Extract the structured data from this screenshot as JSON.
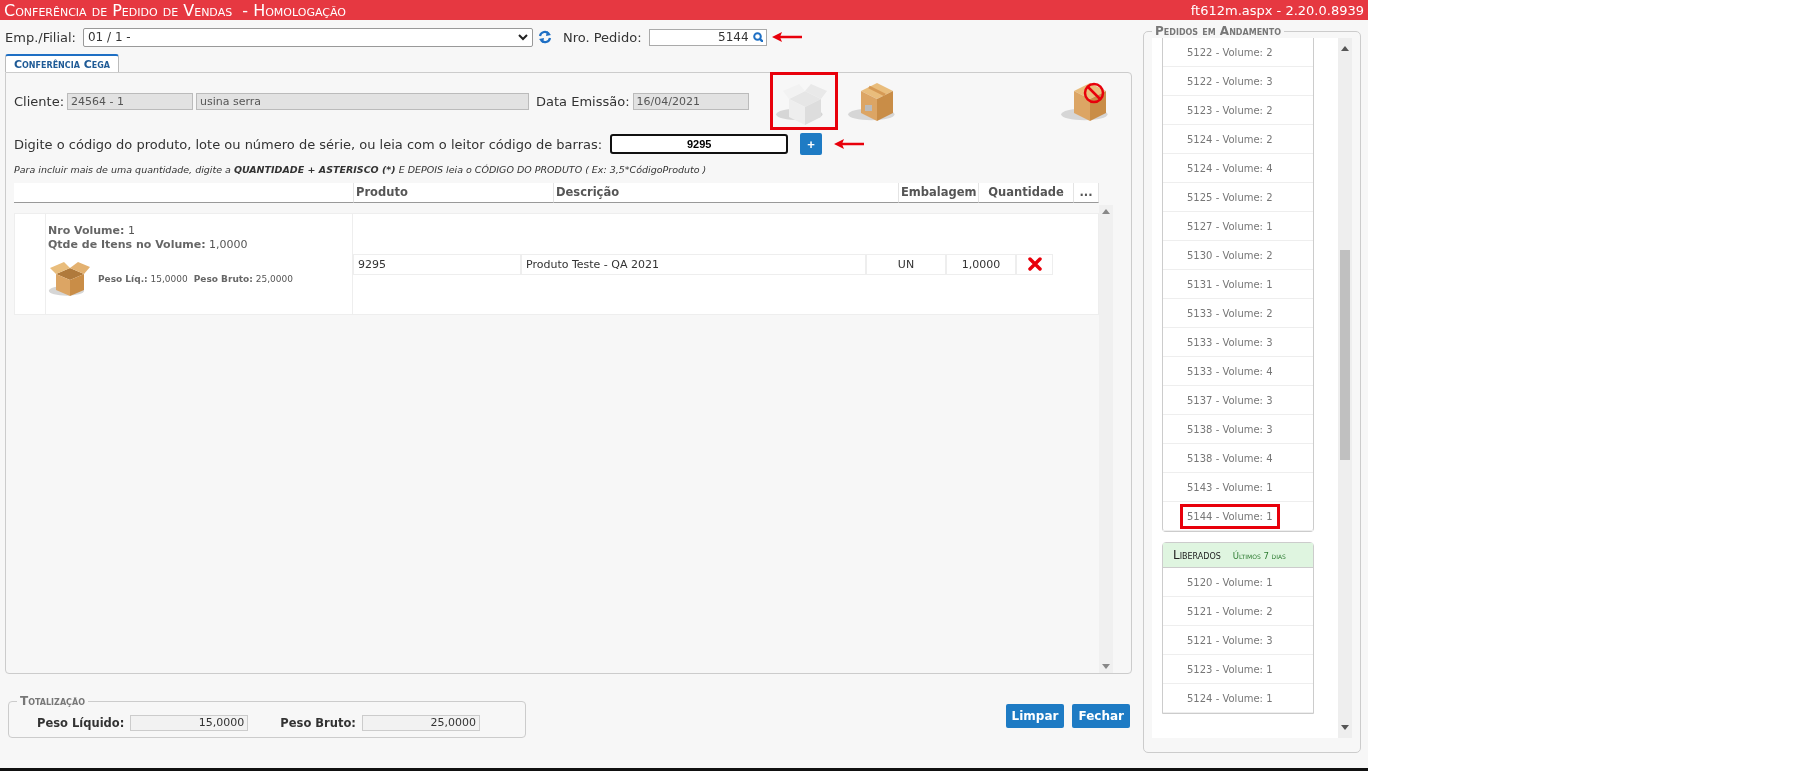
{
  "header": {
    "title": "Conferência de Pedido de Vendas  - Homologação",
    "version": "ft612m.aspx - 2.20.0.8939"
  },
  "filter": {
    "branch_label": "Emp./Filial:",
    "branch_value": "01 / 1 -",
    "order_label": "Nro. Pedido:",
    "order_value": "5144",
    "annotated": true
  },
  "tabs": [
    {
      "label": "Conferência Cega",
      "selected": true
    }
  ],
  "order": {
    "client_label": "Cliente:",
    "client_code": "24564 - 1",
    "client_name": "usina serra",
    "date_label": "Data Emissão:",
    "date_value": "16/04/2021"
  },
  "box_actions": [
    {
      "kind": "empty",
      "highlighted": true
    },
    {
      "kind": "closed",
      "highlighted": false
    },
    {
      "kind": "blocked",
      "highlighted": false
    }
  ],
  "scan": {
    "label": "Digite o código do produto, lote ou número de série, ou leia com o leitor código de barras:",
    "value": "9295",
    "add_button": "+",
    "annotated": true
  },
  "hint": [
    {
      "text": "Para incluir mais de uma quantidade, digite a ",
      "bold": false
    },
    {
      "text": "QUANTIDADE + ASTERISCO (*)",
      "bold": true
    },
    {
      "text": " E DEPOIS leia o CÓDIGO DO PRODUTO ( Ex: 3,5*CódigoProduto )",
      "bold": false
    }
  ],
  "table": {
    "columns": [
      "Produto",
      "Descrição",
      "Embalagem",
      "Quantidade",
      "..."
    ],
    "volumes": [
      {
        "volume": "**Nro Volume:** 1",
        "items_count": "**Qtde de Itens no Volume:** 1,0000",
        "net_weight": "**Peso Líq.:** 15,0000",
        "gross_weight": "**Peso Bruto:** 25,0000",
        "items": [
          {
            "produto": "9295",
            "descricao": "Produto Teste - QA 2021",
            "embalagem": "UN",
            "quantidade": "1,0000"
          }
        ]
      }
    ]
  },
  "totals": {
    "title": "Totalização",
    "net_label": "Peso Líquido:",
    "net_value": "15,0000",
    "gross_label": "Peso Bruto:",
    "gross_value": "25,0000"
  },
  "buttons": [
    "Limpar",
    "Fechar"
  ],
  "side": {
    "in_progress": {
      "title": "Pedidos em Andamento",
      "items": [
        {
          "label": "5122 - Volume: 2",
          "selected": false
        },
        {
          "label": "5122 - Volume: 3",
          "selected": false
        },
        {
          "label": "5123 - Volume: 2",
          "selected": false
        },
        {
          "label": "5124 - Volume: 2",
          "selected": false
        },
        {
          "label": "5124 - Volume: 4",
          "selected": false
        },
        {
          "label": "5125 - Volume: 2",
          "selected": false
        },
        {
          "label": "5127 - Volume: 1",
          "selected": false
        },
        {
          "label": "5130 - Volume: 2",
          "selected": false
        },
        {
          "label": "5131 - Volume: 1",
          "selected": false
        },
        {
          "label": "5133 - Volume: 2",
          "selected": false
        },
        {
          "label": "5133 - Volume: 3",
          "selected": false
        },
        {
          "label": "5133 - Volume: 4",
          "selected": false
        },
        {
          "label": "5137 - Volume: 3",
          "selected": false
        },
        {
          "label": "5138 - Volume: 3",
          "selected": false
        },
        {
          "label": "5138 - Volume: 4",
          "selected": false
        },
        {
          "label": "5143 - Volume: 1",
          "selected": false
        },
        {
          "label": "5144 - Volume: 1",
          "selected": true
        }
      ]
    },
    "released": {
      "title": "Liberados",
      "subtitle": "Últimos 7 dias",
      "items": [
        {
          "label": "5120 - Volume: 1",
          "selected": false
        },
        {
          "label": "5121 - Volume: 2",
          "selected": false
        },
        {
          "label": "5121 - Volume: 3",
          "selected": false
        },
        {
          "label": "5123 - Volume: 1",
          "selected": false
        },
        {
          "label": "5124 - Volume: 1",
          "selected": false
        }
      ]
    }
  }
}
